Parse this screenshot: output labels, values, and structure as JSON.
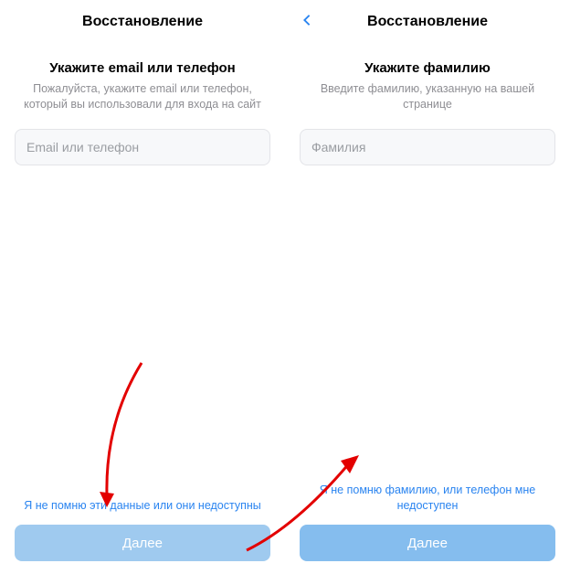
{
  "left": {
    "header": {
      "title": "Восстановление"
    },
    "subtitle": "Укажите email или телефон",
    "subtext": "Пожалуйста, укажите email или телефон, который вы использовали для входа на сайт",
    "input": {
      "placeholder": "Email или телефон"
    },
    "forgot_link": "Я не помню эти данные или они недоступны",
    "next_label": "Далее"
  },
  "right": {
    "header": {
      "title": "Восстановление"
    },
    "subtitle": "Укажите фамилию",
    "subtext": "Введите фамилию, указанную на вашей странице",
    "input": {
      "placeholder": "Фамилия"
    },
    "forgot_link": "Я не помню фамилию, или телефон мне недоступен",
    "next_label": "Далее"
  }
}
